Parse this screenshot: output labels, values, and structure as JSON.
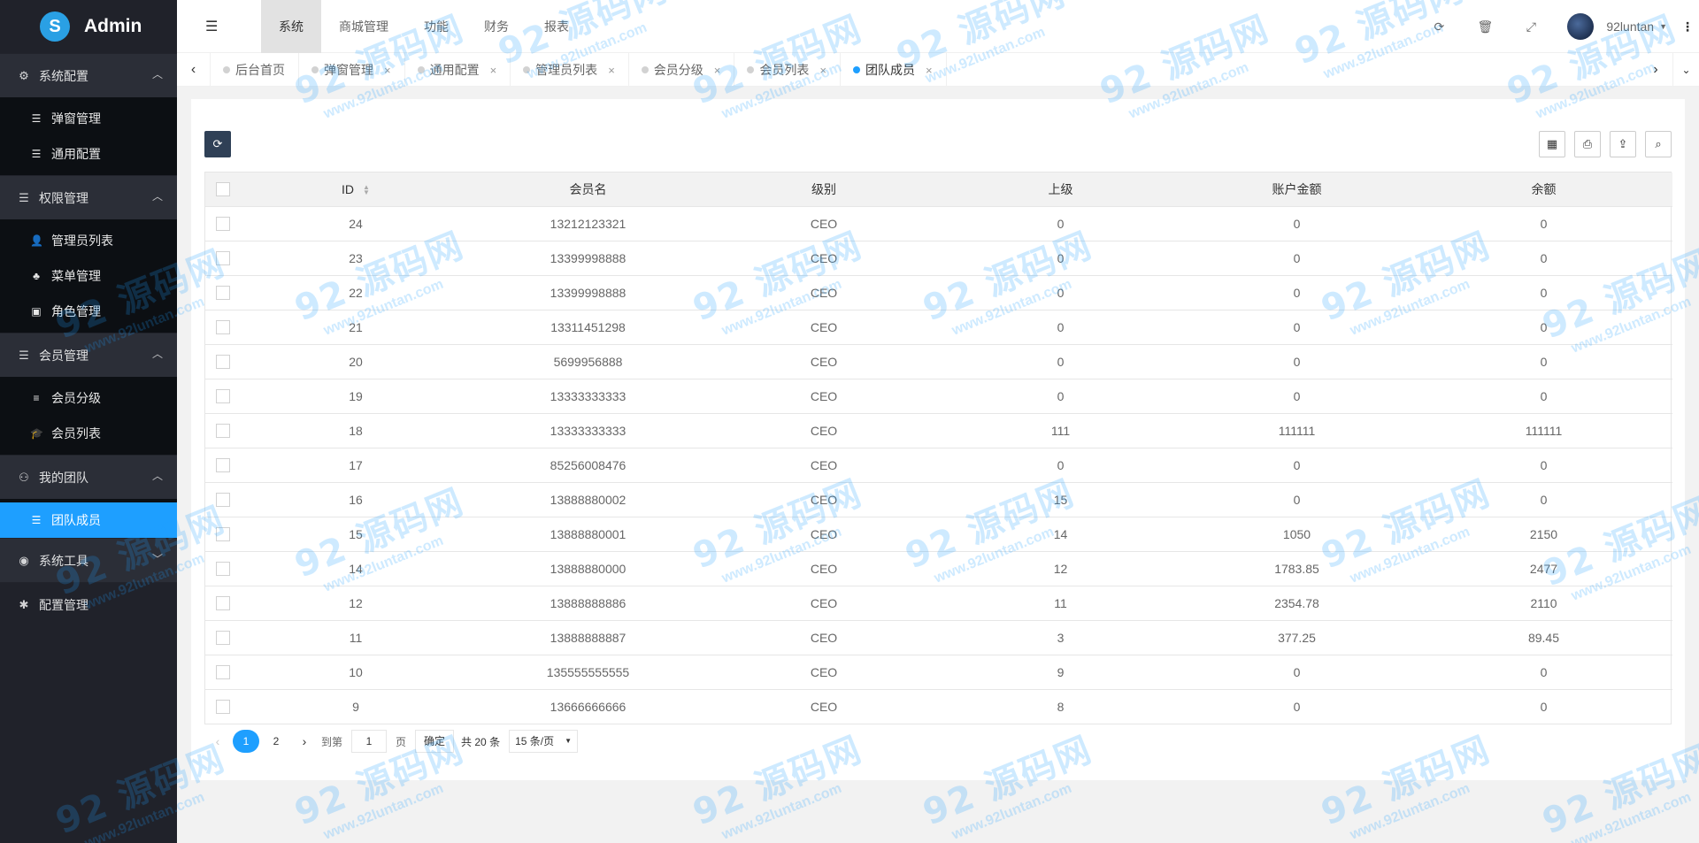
{
  "app": {
    "title": "Admin",
    "logo_letter": "S"
  },
  "sidebar": {
    "groups": [
      {
        "icon": "⚙",
        "label": "系统配置",
        "arrow": "︿",
        "items": [
          {
            "icon": "☰",
            "label": "弹窗管理"
          },
          {
            "icon": "☰",
            "label": "通用配置"
          }
        ]
      },
      {
        "icon": "☰",
        "label": "权限管理",
        "arrow": "︿",
        "items": [
          {
            "icon": "👤",
            "label": "管理员列表"
          },
          {
            "icon": "♣",
            "label": "菜单管理"
          },
          {
            "icon": "▣",
            "label": "角色管理"
          }
        ]
      },
      {
        "icon": "☰",
        "label": "会员管理",
        "arrow": "︿",
        "items": [
          {
            "icon": "≡",
            "label": "会员分级"
          },
          {
            "icon": "🎓",
            "label": "会员列表"
          }
        ]
      },
      {
        "icon": "⚇",
        "label": "我的团队",
        "arrow": "︿",
        "items": [
          {
            "icon": "☰",
            "label": "团队成员"
          }
        ]
      },
      {
        "icon": "◉",
        "label": "系统工具",
        "arrow": "﹀",
        "items": []
      },
      {
        "icon": "✱",
        "label": "配置管理",
        "arrow": "",
        "items": []
      }
    ]
  },
  "header": {
    "toggle_icon": "☰",
    "menu": [
      "系统",
      "商城管理",
      "功能",
      "财务",
      "报表"
    ],
    "icons": {
      "refresh": "⟳",
      "trash": "🗑",
      "fullscreen": "⤢"
    },
    "username": "92luntan",
    "caret": "▼",
    "more": "⋮"
  },
  "tabs": {
    "prev": "‹",
    "next": "›",
    "down": "⌄",
    "items": [
      {
        "label": "后台首页",
        "closable": false
      },
      {
        "label": "弹窗管理",
        "closable": true
      },
      {
        "label": "通用配置",
        "closable": true
      },
      {
        "label": "管理员列表",
        "closable": true
      },
      {
        "label": "会员分级",
        "closable": true
      },
      {
        "label": "会员列表",
        "closable": true
      },
      {
        "label": "团队成员",
        "closable": true
      }
    ],
    "close_glyph": "×"
  },
  "toolbar": {
    "refresh_icon": "⟳",
    "right_icons": [
      "▦",
      "⎙",
      "⇪",
      "⌕"
    ]
  },
  "table": {
    "columns": [
      "ID",
      "会员名",
      "级别",
      "上级",
      "账户金额",
      "余额"
    ],
    "sort_glyph": "▲▼",
    "rows": [
      [
        "24",
        "13212123321",
        "CEO",
        "0",
        "0",
        "0"
      ],
      [
        "23",
        "13399998888",
        "CEO",
        "0",
        "0",
        "0"
      ],
      [
        "22",
        "13399998888",
        "CEO",
        "0",
        "0",
        "0"
      ],
      [
        "21",
        "13311451298",
        "CEO",
        "0",
        "0",
        "0"
      ],
      [
        "20",
        "5699956888",
        "CEO",
        "0",
        "0",
        "0"
      ],
      [
        "19",
        "13333333333",
        "CEO",
        "0",
        "0",
        "0"
      ],
      [
        "18",
        "13333333333",
        "CEO",
        "111",
        "111111",
        "111111"
      ],
      [
        "17",
        "85256008476",
        "CEO",
        "0",
        "0",
        "0"
      ],
      [
        "16",
        "13888880002",
        "CEO",
        "15",
        "0",
        "0"
      ],
      [
        "15",
        "13888880001",
        "CEO",
        "14",
        "1050",
        "2150"
      ],
      [
        "14",
        "13888880000",
        "CEO",
        "12",
        "1783.85",
        "2477"
      ],
      [
        "12",
        "13888888886",
        "CEO",
        "11",
        "2354.78",
        "2110"
      ],
      [
        "11",
        "13888888887",
        "CEO",
        "3",
        "377.25",
        "89.45"
      ],
      [
        "10",
        "135555555555",
        "CEO",
        "9",
        "0",
        "0"
      ],
      [
        "9",
        "13666666666",
        "CEO",
        "8",
        "0",
        "0"
      ]
    ]
  },
  "pager": {
    "prev": "‹",
    "pages": [
      "1",
      "2"
    ],
    "current": "1",
    "next": "›",
    "goto_label": "到第",
    "goto_value": "1",
    "page_label": "页",
    "confirm": "确定",
    "total": "共 20 条",
    "per_page": "15 条/页",
    "select_caret": "▼"
  },
  "watermark": {
    "big": "92 源码网",
    "small": "www.92luntan.com"
  },
  "colors": {
    "accent": "#1e9fff",
    "sidebar_bg": "#20222a",
    "submenu_bg": "#0c0f13",
    "dark_btn": "#2f4056"
  }
}
